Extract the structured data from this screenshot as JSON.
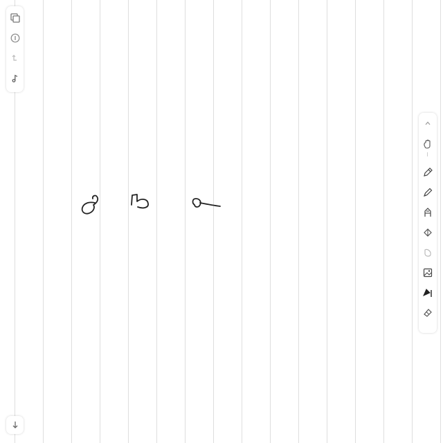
{
  "canvas": {
    "background": "#ffffff",
    "line_color": "#dedede",
    "ink_color": "#222222",
    "handwritten_digits": [
      "6",
      "5",
      "9"
    ]
  },
  "left_toolbar": {
    "tools": [
      {
        "name": "pages-icon"
      },
      {
        "name": "info-icon"
      },
      {
        "name": "undo-icon"
      },
      {
        "name": "music-note-icon"
      }
    ]
  },
  "right_toolbar": {
    "tools": [
      {
        "name": "collapse-chevron-icon"
      },
      {
        "name": "lasso-hand-icon"
      },
      {
        "name": "pen-icon"
      },
      {
        "name": "pencil-icon"
      },
      {
        "name": "brush-icon"
      },
      {
        "name": "highlighter-icon"
      },
      {
        "name": "shape-icon"
      },
      {
        "name": "image-icon"
      },
      {
        "name": "ink-pen-icon"
      },
      {
        "name": "eraser-icon"
      }
    ]
  },
  "bottom": {
    "scroll_down": {
      "name": "arrow-down-icon"
    }
  }
}
